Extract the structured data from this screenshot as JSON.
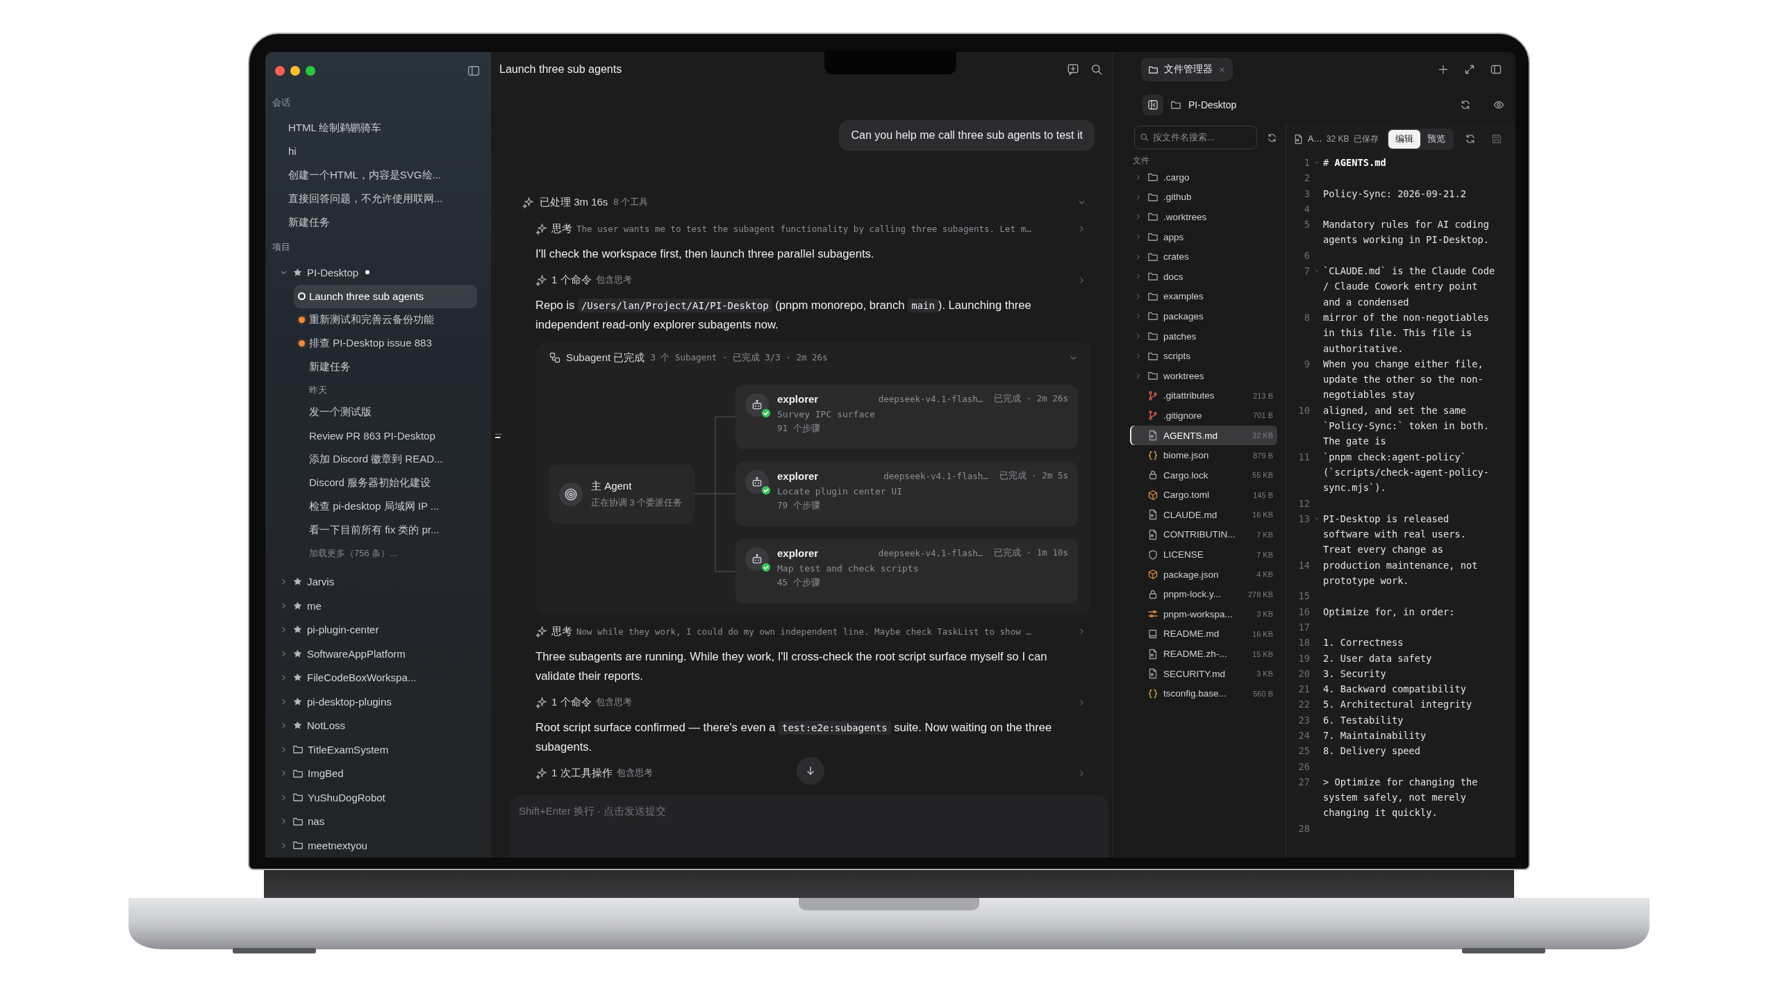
{
  "sidebar": {
    "conversations_label": "会话",
    "conversations": [
      "HTML 绘制鹈鹕骑车",
      "hi",
      "创建一个HTML，内容是SVG绘...",
      "直接回答问题，不允许使用联网...",
      "新建任务"
    ],
    "projects_label": "项目",
    "projects": [
      {
        "name": "PI-Desktop",
        "kind": "starred",
        "expanded": true,
        "unread": true,
        "children": [
          {
            "kind": "task",
            "label": "Launch three sub agents",
            "active": true,
            "selected": true
          },
          {
            "kind": "task",
            "label": "重新测试和完善云备份功能",
            "active": false,
            "color": "#f08a3c",
            "selected": false
          },
          {
            "kind": "task",
            "label": "排查 PI-Desktop issue 883",
            "active": false,
            "color": "#f08a3c",
            "selected": false
          },
          {
            "kind": "task",
            "label": "新建任务",
            "selected": false
          },
          {
            "kind": "heading",
            "label": "昨天"
          },
          {
            "kind": "task",
            "label": "发一个测试版",
            "selected": false
          },
          {
            "kind": "task",
            "label": "Review PR 863 PI-Desktop",
            "selected": false
          },
          {
            "kind": "task",
            "label": "添加 Discord 徽章到 READ...",
            "selected": false
          },
          {
            "kind": "task",
            "label": "Discord 服务器初始化建设",
            "selected": false
          },
          {
            "kind": "task",
            "label": "检查 pi-desktop 局域网 IP ...",
            "selected": false
          },
          {
            "kind": "task",
            "label": "看一下目前所有 fix 类的 pr...",
            "selected": false
          },
          {
            "kind": "more",
            "label": "加载更多（756 条）..."
          }
        ]
      },
      {
        "name": "Jarvis",
        "kind": "starred",
        "expanded": false,
        "unread": false
      },
      {
        "name": "me",
        "kind": "starred",
        "expanded": false,
        "unread": false
      },
      {
        "name": "pi-plugin-center",
        "kind": "starred",
        "expanded": false,
        "unread": false
      },
      {
        "name": "SoftwareAppPlatform",
        "kind": "starred",
        "expanded": false,
        "unread": false
      },
      {
        "name": "FileCodeBoxWorkspa...",
        "kind": "starred",
        "expanded": false,
        "unread": false
      },
      {
        "name": "pi-desktop-plugins",
        "kind": "starred",
        "expanded": false,
        "unread": false
      },
      {
        "name": "NotLoss",
        "kind": "starred",
        "expanded": false,
        "unread": false
      },
      {
        "name": "TitleExamSystem",
        "kind": "folder",
        "expanded": false,
        "unread": false
      },
      {
        "name": "ImgBed",
        "kind": "folder",
        "expanded": false,
        "unread": false
      },
      {
        "name": "YuShuDogRobot",
        "kind": "folder",
        "expanded": false,
        "unread": false
      },
      {
        "name": "nas",
        "kind": "folder",
        "expanded": false,
        "unread": false
      },
      {
        "name": "meetnextyou",
        "kind": "folder",
        "expanded": false,
        "unread": false
      }
    ]
  },
  "chat": {
    "title": "Launch three sub agents",
    "messages": [
      {
        "kind": "user",
        "text": "Can you help me call three sub agents to test it"
      },
      {
        "kind": "process",
        "label": "已处理 3m 16s",
        "detail": "8 个工具",
        "expanded": true
      },
      {
        "kind": "thought",
        "label": "思考",
        "text": "The user wants me to test the subagent functionality by calling three subagents. Let m…",
        "expanded": false
      },
      {
        "kind": "text",
        "parts": [
          {
            "kind": "plain",
            "text": "I'll check the workspace first, then launch three parallel subagents."
          }
        ]
      },
      {
        "kind": "tool",
        "label": "1 个命令",
        "detail": "包含思考",
        "expanded": false
      },
      {
        "kind": "text",
        "parts": [
          {
            "kind": "plain",
            "text": "Repo is "
          },
          {
            "kind": "code",
            "text": "/Users/lan/Project/AI/PI-Desktop"
          },
          {
            "kind": "plain",
            "text": " (pnpm monorepo, branch "
          },
          {
            "kind": "code",
            "text": "main"
          },
          {
            "kind": "plain",
            "text": "). Launching three independent read-only explorer subagents now."
          }
        ]
      },
      {
        "kind": "subagents",
        "label": "Subagent 已完成",
        "summary": "3 个 Subagent · 已完成 3/3 · 2m 26s",
        "expanded": true,
        "main": {
          "name": "主 Agent",
          "status": "正在协调 3 个委派任务"
        },
        "agents": [
          {
            "name": "explorer",
            "model": "deepseek-v4.1-flash…",
            "status": "已完成 · 2m 26s",
            "task": "Survey IPC surface",
            "steps": "91 个步骤",
            "done": true
          },
          {
            "name": "explorer",
            "model": "deepseek-v4.1-flash…",
            "status": "已完成 · 2m 5s",
            "task": "Locate plugin center UI",
            "steps": "79 个步骤",
            "done": true
          },
          {
            "name": "explorer",
            "model": "deepseek-v4.1-flash…",
            "status": "已完成 · 1m 10s",
            "task": "Map test and check scripts",
            "steps": "45 个步骤",
            "done": true
          }
        ]
      },
      {
        "kind": "thought",
        "label": "思考",
        "text": "Now while they work, I could do my own independent line. Maybe check TaskList to show …",
        "expanded": false
      },
      {
        "kind": "text",
        "parts": [
          {
            "kind": "plain",
            "text": "Three subagents are running. While they work, I'll cross-check the root script surface myself so I can validate their reports."
          }
        ]
      },
      {
        "kind": "tool",
        "label": "1 个命令",
        "detail": "包含思考",
        "expanded": false
      },
      {
        "kind": "text",
        "parts": [
          {
            "kind": "plain",
            "text": "Root script surface confirmed — there's even a "
          },
          {
            "kind": "code",
            "text": "test:e2e:subagents"
          },
          {
            "kind": "plain",
            "text": " suite. Now waiting on the three subagents."
          }
        ]
      },
      {
        "kind": "tool",
        "label": "1 次工具操作",
        "detail": "包含思考",
        "expanded": false
      }
    ],
    "composer": {
      "placeholder": "Shift+Enter 换行 · 点击发送提交"
    }
  },
  "files_panel": {
    "tab": "文件管理器",
    "root": "PI-Desktop",
    "search": {
      "placeholder": "按文件名搜索..."
    },
    "section_label": "文件",
    "files": [
      {
        "name": ".cargo",
        "kind": "folder",
        "selected": false
      },
      {
        "name": ".github",
        "kind": "folder",
        "selected": false
      },
      {
        "name": ".worktrees",
        "kind": "folder",
        "selected": false
      },
      {
        "name": "apps",
        "kind": "folder",
        "selected": false
      },
      {
        "name": "crates",
        "kind": "folder",
        "selected": false
      },
      {
        "name": "docs",
        "kind": "folder",
        "selected": false
      },
      {
        "name": "examples",
        "kind": "folder",
        "selected": false
      },
      {
        "name": "packages",
        "kind": "folder",
        "selected": false
      },
      {
        "name": "patches",
        "kind": "folder",
        "selected": false
      },
      {
        "name": "scripts",
        "kind": "folder",
        "selected": false
      },
      {
        "name": "worktrees",
        "kind": "folder",
        "selected": false
      },
      {
        "name": ".gitattributes",
        "kind": "git",
        "size": "213 B",
        "selected": false
      },
      {
        "name": ".gitignore",
        "kind": "git",
        "size": "701 B",
        "selected": false
      },
      {
        "name": "AGENTS.md",
        "kind": "markdown",
        "size": "32 KB",
        "selected": true
      },
      {
        "name": "biome.json",
        "kind": "json",
        "size": "879 B",
        "selected": false
      },
      {
        "name": "Cargo.lock",
        "kind": "lock",
        "size": "55 KB",
        "selected": false
      },
      {
        "name": "Cargo.toml",
        "kind": "package",
        "size": "145 B",
        "selected": false
      },
      {
        "name": "CLAUDE.md",
        "kind": "markdown",
        "size": "16 KB",
        "selected": false
      },
      {
        "name": "CONTRIBUTIN...",
        "kind": "markdown",
        "size": "7 KB",
        "selected": false
      },
      {
        "name": "LICENSE",
        "kind": "license",
        "size": "7 KB",
        "selected": false
      },
      {
        "name": "package.json",
        "kind": "package",
        "size": "4 KB",
        "selected": false
      },
      {
        "name": "pnpm-lock.y...",
        "kind": "lock",
        "size": "278 KB",
        "selected": false
      },
      {
        "name": "pnpm-workspa...",
        "kind": "settings",
        "size": "3 KB",
        "selected": false
      },
      {
        "name": "README.md",
        "kind": "book",
        "size": "16 KB",
        "selected": false
      },
      {
        "name": "README.zh-...",
        "kind": "markdown",
        "size": "15 KB",
        "selected": false
      },
      {
        "name": "SECURITY.md",
        "kind": "markdown",
        "size": "3 KB",
        "selected": false
      },
      {
        "name": "tsconfig.base...",
        "kind": "json",
        "size": "560 B",
        "selected": false
      }
    ]
  },
  "editor": {
    "file": "A…",
    "size": "32 KB",
    "save_state": "已保存",
    "modes": [
      {
        "label": "编辑",
        "selected": true
      },
      {
        "label": "预览",
        "selected": false
      }
    ],
    "lines": [
      {
        "number": "1",
        "text": "# **AGENTS.md**",
        "foldable": true
      },
      {
        "number": "2",
        "foldable": false
      },
      {
        "number": "3",
        "text": "Policy-Sync: 2026-09-21.2",
        "foldable": false
      },
      {
        "number": "4",
        "foldable": false
      },
      {
        "number": "5",
        "text": "Mandatory rules for AI coding agents working in PI-Desktop.",
        "foldable": false
      },
      {
        "number": "6",
        "foldable": false
      },
      {
        "number": "7",
        "text": "`CLAUDE.md` is the Claude Code / Claude Cowork entry point and a condensed",
        "foldable": true
      },
      {
        "number": "8",
        "text": "mirror of the non-negotiables in this file. This file is authoritative.",
        "foldable": false
      },
      {
        "number": "9",
        "text": "When you change either file, update the other so the non-negotiables stay",
        "foldable": false
      },
      {
        "number": "10",
        "text": "aligned, and set the same `Policy-Sync:` token in both. The gate is",
        "foldable": false
      },
      {
        "number": "11",
        "text": "`pnpm check:agent-policy` (`scripts/check-agent-policy-sync.mjs`).",
        "foldable": false
      },
      {
        "number": "12",
        "foldable": false
      },
      {
        "number": "13",
        "text": "PI-Desktop is released software with real users. Treat every change as",
        "foldable": true
      },
      {
        "number": "14",
        "text": "production maintenance, not prototype work.",
        "foldable": false
      },
      {
        "number": "15",
        "foldable": false
      },
      {
        "number": "16",
        "text": "Optimize for, in order:",
        "foldable": false
      },
      {
        "number": "17",
        "foldable": false
      },
      {
        "number": "18",
        "text": "1. Correctness",
        "foldable": false
      },
      {
        "number": "19",
        "text": "2. User data safety",
        "foldable": false
      },
      {
        "number": "20",
        "text": "3. Security",
        "foldable": false
      },
      {
        "number": "21",
        "text": "4. Backward compatibility",
        "foldable": false
      },
      {
        "number": "22",
        "text": "5. Architectural integrity",
        "foldable": false
      },
      {
        "number": "23",
        "text": "6. Testability",
        "foldable": false
      },
      {
        "number": "24",
        "text": "7. Maintainability",
        "foldable": false
      },
      {
        "number": "25",
        "text": "8. Delivery speed",
        "foldable": false
      },
      {
        "number": "26",
        "foldable": false
      },
      {
        "number": "27",
        "text": "> Optimize for changing the system safely, not merely changing it quickly.",
        "foldable": false
      },
      {
        "number": "28",
        "foldable": false
      }
    ]
  }
}
